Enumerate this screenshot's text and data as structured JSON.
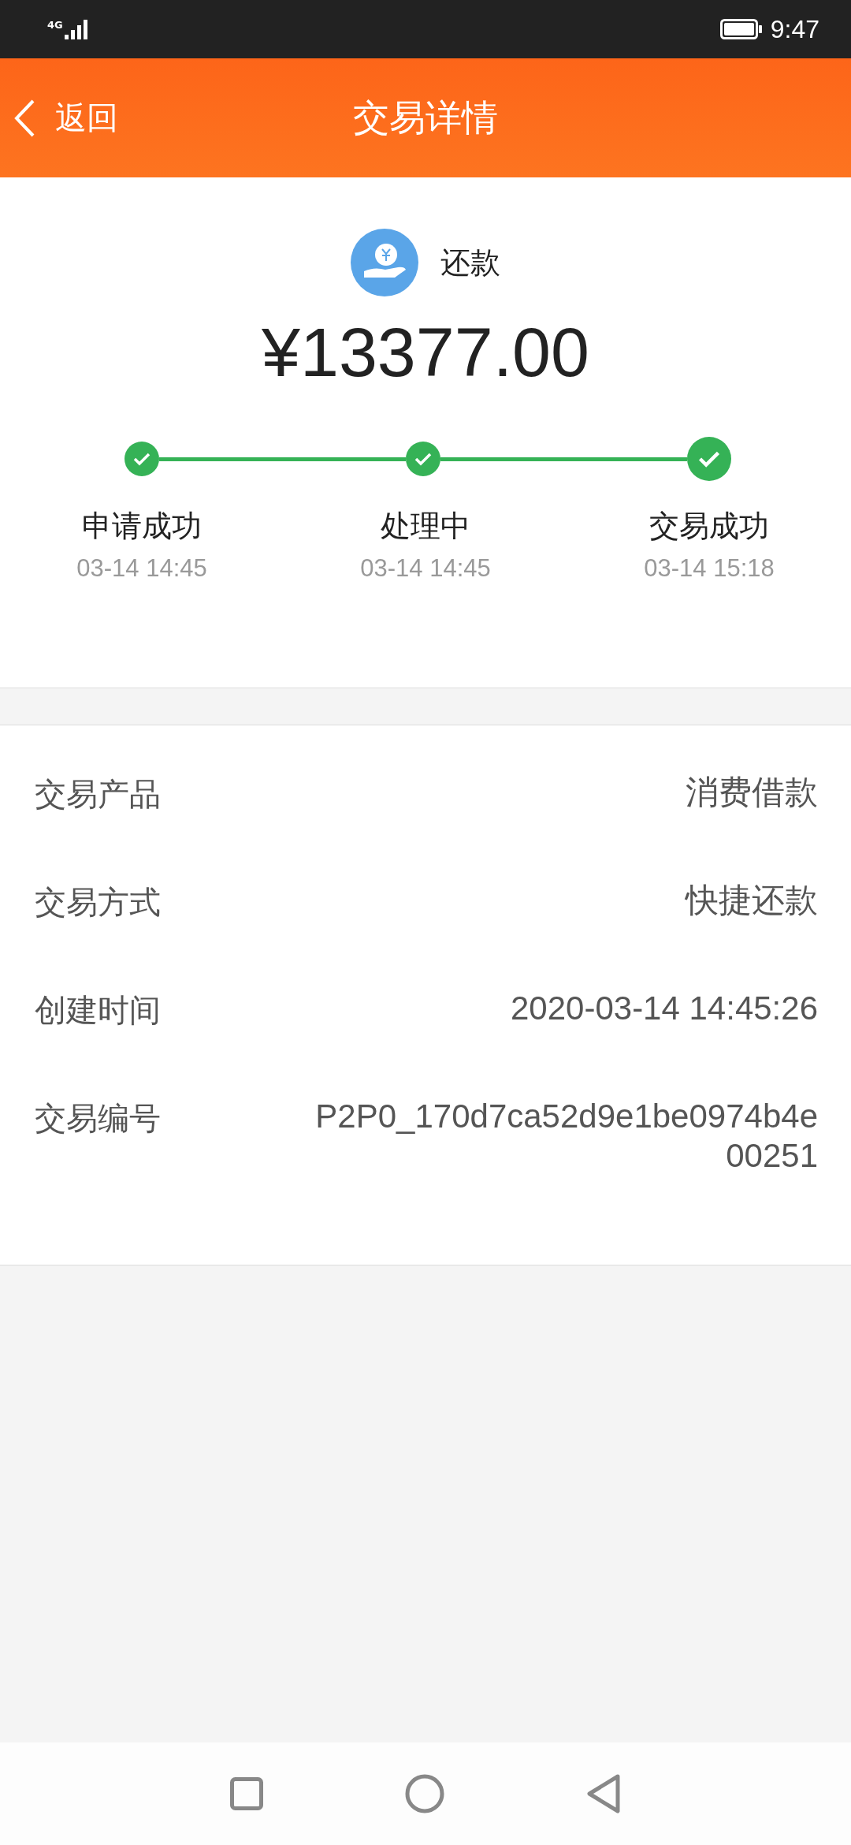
{
  "status_bar": {
    "network": "4G",
    "time": "9:47"
  },
  "header": {
    "back": "返回",
    "title": "交易详情"
  },
  "summary": {
    "type": "还款",
    "amount": "¥13377.00"
  },
  "steps": [
    {
      "label": "申请成功",
      "time": "03-14 14:45",
      "kind": "done"
    },
    {
      "label": "处理中",
      "time": "03-14 14:45",
      "kind": "done"
    },
    {
      "label": "交易成功",
      "time": "03-14 15:18",
      "kind": "current"
    }
  ],
  "details": [
    {
      "label": "交易产品",
      "value": "消费借款"
    },
    {
      "label": "交易方式",
      "value": "快捷还款"
    },
    {
      "label": "创建时间",
      "value": "2020-03-14 14:45:26"
    },
    {
      "label": "交易编号",
      "value": "P2P0_170d7ca52d9e1be0974b4e00251"
    }
  ]
}
